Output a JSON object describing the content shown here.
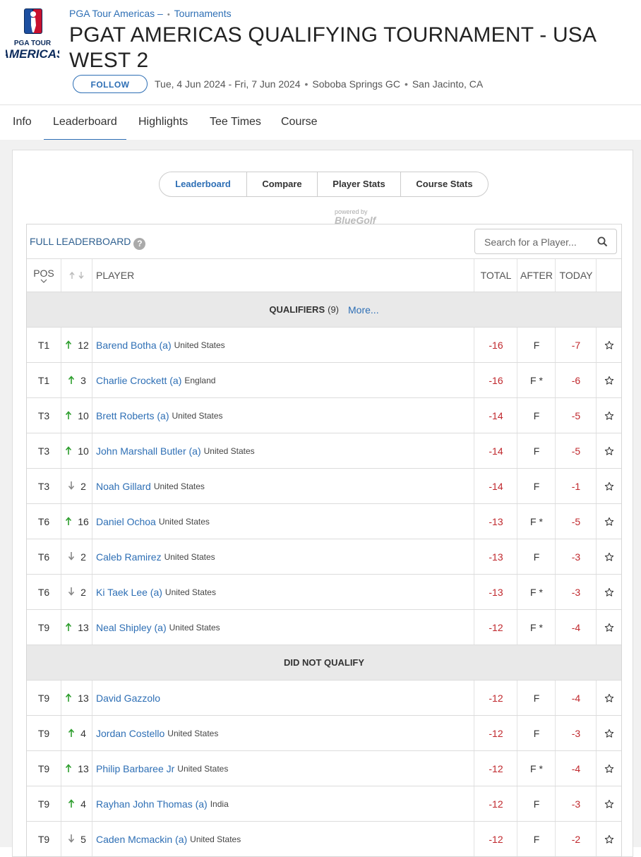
{
  "breadcrumb": {
    "tour": "PGA Tour Americas –",
    "section": "Tournaments"
  },
  "logo": {
    "line1": "PGA TOUR",
    "line2": "AMERICAS"
  },
  "tournament": {
    "title": "PGAT AMERICAS QUALIFYING TOURNAMENT - USA WEST 2",
    "follow_label": "FOLLOW",
    "dates": "Tue, 4 Jun 2024 - Fri, 7 Jun 2024",
    "course": "Soboba Springs GC",
    "location": "San Jacinto, CA"
  },
  "tabs": [
    "Info",
    "Leaderboard",
    "Highlights",
    "Tee Times",
    "Course"
  ],
  "segments": [
    "Leaderboard",
    "Compare",
    "Player Stats",
    "Course Stats"
  ],
  "powered": {
    "line1": "powered by",
    "line2": "BlueGolf"
  },
  "board": {
    "label": "FULL LEADERBOARD",
    "search_placeholder": "Search for a Player...",
    "columns": {
      "pos": "POS",
      "player": "PLAYER",
      "total": "TOTAL",
      "after": "AFTER",
      "today": "TODAY"
    }
  },
  "qualifiers": {
    "label": "QUALIFIERS",
    "count": "(9)",
    "more": "More...",
    "rows": [
      {
        "pos": "T1",
        "dir": "up",
        "move": "12",
        "name": "Barend Botha (a)",
        "country": "United States",
        "total": "-16",
        "after": "F",
        "today": "-7"
      },
      {
        "pos": "T1",
        "dir": "up",
        "move": "3",
        "name": "Charlie Crockett (a)",
        "country": "England",
        "total": "-16",
        "after": "F *",
        "today": "-6"
      },
      {
        "pos": "T3",
        "dir": "up",
        "move": "10",
        "name": "Brett Roberts (a)",
        "country": "United States",
        "total": "-14",
        "after": "F",
        "today": "-5"
      },
      {
        "pos": "T3",
        "dir": "up",
        "move": "10",
        "name": "John Marshall Butler (a)",
        "country": "United States",
        "total": "-14",
        "after": "F",
        "today": "-5"
      },
      {
        "pos": "T3",
        "dir": "down",
        "move": "2",
        "name": "Noah Gillard",
        "country": "United States",
        "total": "-14",
        "after": "F",
        "today": "-1"
      },
      {
        "pos": "T6",
        "dir": "up",
        "move": "16",
        "name": "Daniel Ochoa",
        "country": "United States",
        "total": "-13",
        "after": "F *",
        "today": "-5"
      },
      {
        "pos": "T6",
        "dir": "down",
        "move": "2",
        "name": "Caleb Ramirez",
        "country": "United States",
        "total": "-13",
        "after": "F",
        "today": "-3"
      },
      {
        "pos": "T6",
        "dir": "down",
        "move": "2",
        "name": "Ki Taek Lee (a)",
        "country": "United States",
        "total": "-13",
        "after": "F *",
        "today": "-3"
      },
      {
        "pos": "T9",
        "dir": "up",
        "move": "13",
        "name": "Neal Shipley (a)",
        "country": "United States",
        "total": "-12",
        "after": "F *",
        "today": "-4"
      }
    ]
  },
  "non_qualifiers": {
    "label": "DID NOT QUALIFY",
    "rows": [
      {
        "pos": "T9",
        "dir": "up",
        "move": "13",
        "name": "David Gazzolo",
        "country": "",
        "total": "-12",
        "after": "F",
        "today": "-4"
      },
      {
        "pos": "T9",
        "dir": "up",
        "move": "4",
        "name": "Jordan Costello",
        "country": "United States",
        "total": "-12",
        "after": "F",
        "today": "-3"
      },
      {
        "pos": "T9",
        "dir": "up",
        "move": "13",
        "name": "Philip Barbaree Jr",
        "country": "United States",
        "total": "-12",
        "after": "F *",
        "today": "-4"
      },
      {
        "pos": "T9",
        "dir": "up",
        "move": "4",
        "name": "Rayhan John Thomas (a)",
        "country": "India",
        "total": "-12",
        "after": "F",
        "today": "-3"
      },
      {
        "pos": "T9",
        "dir": "down",
        "move": "5",
        "name": "Caden Mcmackin (a)",
        "country": "United States",
        "total": "-12",
        "after": "F",
        "today": "-2"
      }
    ]
  },
  "colors": {
    "link": "#2e6fb5",
    "score": "#c0282d",
    "up": "#2e9e2e",
    "down": "#888888"
  }
}
